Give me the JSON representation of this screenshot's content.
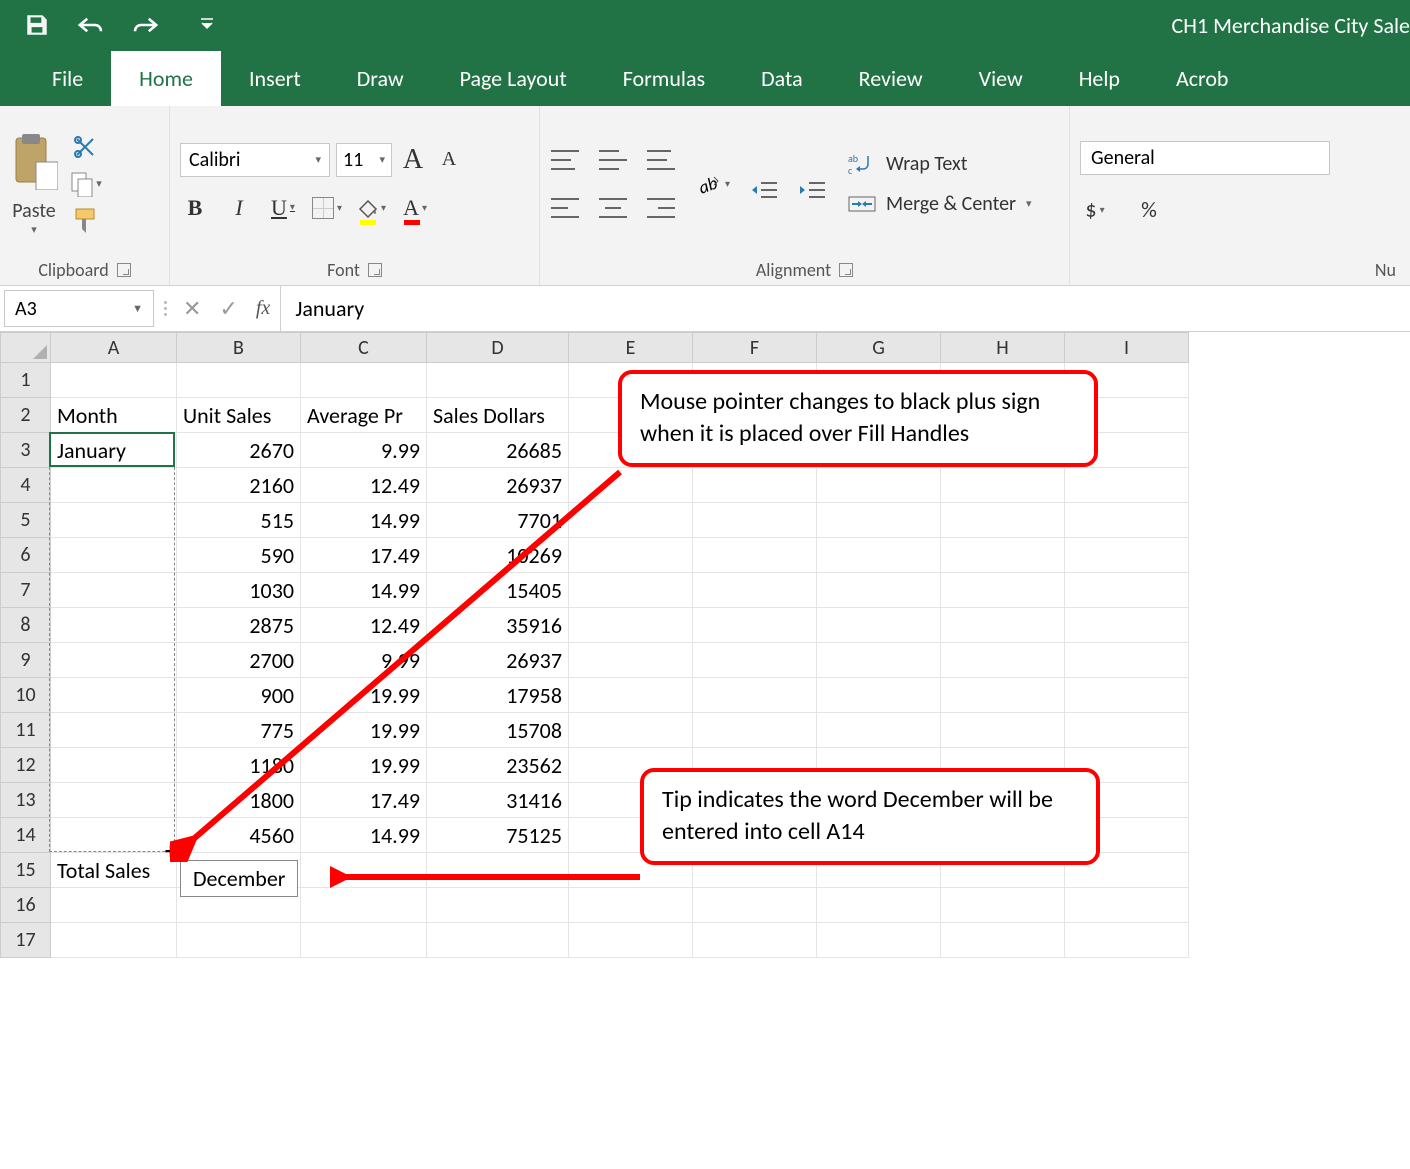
{
  "titlebar": {
    "doc_title": "CH1 Merchandise City Sale"
  },
  "tabs": {
    "file": "File",
    "home": "Home",
    "insert": "Insert",
    "draw": "Draw",
    "page_layout": "Page Layout",
    "formulas": "Formulas",
    "data": "Data",
    "review": "Review",
    "view": "View",
    "help": "Help",
    "acrobat": "Acrob"
  },
  "ribbon": {
    "clipboard": {
      "paste": "Paste",
      "label": "Clipboard"
    },
    "font": {
      "name": "Calibri",
      "size": "11",
      "label": "Font",
      "bold": "B",
      "italic": "I",
      "underline": "U",
      "grow": "A",
      "shrink": "A",
      "fill_letter": "A",
      "color_letter": "A"
    },
    "alignment": {
      "label": "Alignment",
      "wrap": "Wrap Text",
      "merge": "Merge & Center"
    },
    "number": {
      "label": "Nu",
      "format": "General",
      "currency": "$",
      "percent": "%"
    }
  },
  "formula_bar": {
    "name_box": "A3",
    "value": "January",
    "fx": "fx"
  },
  "columns": [
    "A",
    "B",
    "C",
    "D",
    "E",
    "F",
    "G",
    "H",
    "I"
  ],
  "rows": [
    {
      "n": 1,
      "A": "",
      "B": "",
      "C": "",
      "D": ""
    },
    {
      "n": 2,
      "A": "Month",
      "B": "Unit Sales",
      "C": "Average Pr",
      "D": "Sales Dollars"
    },
    {
      "n": 3,
      "A": "January",
      "B": "2670",
      "C": "9.99",
      "D": "26685"
    },
    {
      "n": 4,
      "A": "",
      "B": "2160",
      "C": "12.49",
      "D": "26937"
    },
    {
      "n": 5,
      "A": "",
      "B": "515",
      "C": "14.99",
      "D": "7701"
    },
    {
      "n": 6,
      "A": "",
      "B": "590",
      "C": "17.49",
      "D": "10269"
    },
    {
      "n": 7,
      "A": "",
      "B": "1030",
      "C": "14.99",
      "D": "15405"
    },
    {
      "n": 8,
      "A": "",
      "B": "2875",
      "C": "12.49",
      "D": "35916"
    },
    {
      "n": 9,
      "A": "",
      "B": "2700",
      "C": "9.99",
      "D": "26937"
    },
    {
      "n": 10,
      "A": "",
      "B": "900",
      "C": "19.99",
      "D": "17958"
    },
    {
      "n": 11,
      "A": "",
      "B": "775",
      "C": "19.99",
      "D": "15708"
    },
    {
      "n": 12,
      "A": "",
      "B": "1180",
      "C": "19.99",
      "D": "23562"
    },
    {
      "n": 13,
      "A": "",
      "B": "1800",
      "C": "17.49",
      "D": "31416"
    },
    {
      "n": 14,
      "A": "",
      "B": "4560",
      "C": "14.99",
      "D": "75125"
    },
    {
      "n": 15,
      "A": "Total Sales",
      "B": "",
      "C": "",
      "D": ""
    },
    {
      "n": 16,
      "A": "",
      "B": "",
      "C": "",
      "D": ""
    },
    {
      "n": 17,
      "A": "",
      "B": "",
      "C": "",
      "D": ""
    }
  ],
  "fill_tooltip": "December",
  "callouts": {
    "c1": "Mouse pointer changes to black plus sign when it is placed over Fill Handles",
    "c2": "Tip indicates the word December will be entered into cell A14"
  },
  "icons": {
    "plus": "+"
  }
}
